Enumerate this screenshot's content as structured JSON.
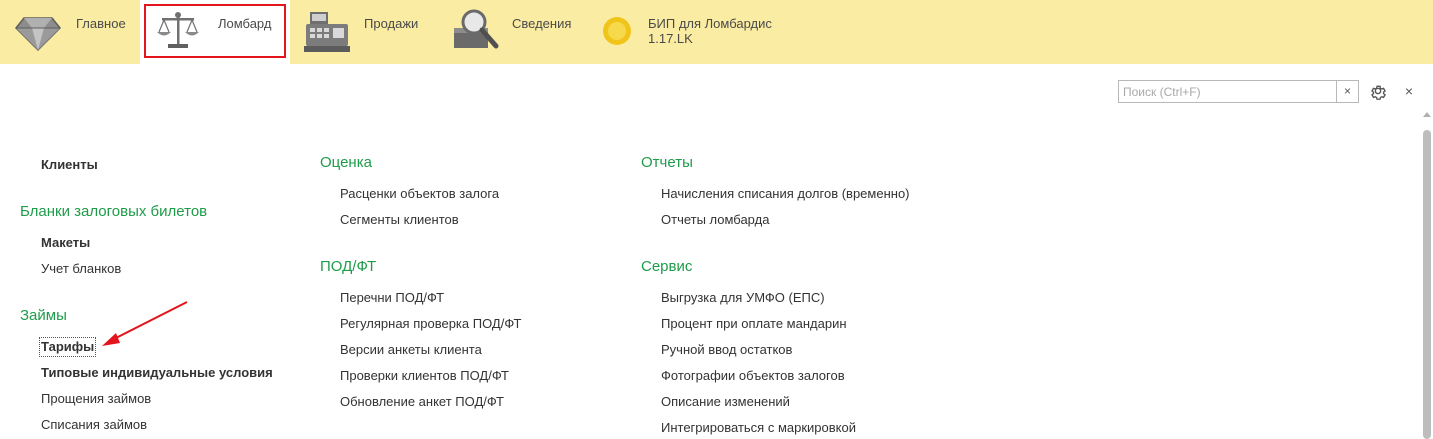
{
  "sections": [
    {
      "label": "Главное",
      "icon": "diamond-icon"
    },
    {
      "label": "Ломбард",
      "icon": "scales-icon"
    },
    {
      "label": "Продажи",
      "icon": "cash-register-icon"
    },
    {
      "label": "Сведения",
      "icon": "magnifier-icon"
    },
    {
      "label": "БИП для Ломбардис",
      "label2": "1.17.LK",
      "icon": "coin-icon"
    }
  ],
  "toolbar": {
    "search_placeholder": "Поиск (Ctrl+F)",
    "search_value": "",
    "clear_glyph": "×",
    "close_glyph": "×"
  },
  "col1": {
    "clients": "Клиенты",
    "blanks_title": "Бланки залоговых билетов",
    "blanks_items": [
      "Макеты",
      "Учет бланков"
    ],
    "loans_title": "Займы",
    "loans_items": [
      "Тарифы",
      "Типовые индивидуальные условия",
      "Прощения займов",
      "Списания займов"
    ]
  },
  "col2": {
    "eval_title": "Оценка",
    "eval_items": [
      "Расценки объектов залога",
      "Сегменты клиентов"
    ],
    "pod_title": "ПОД/ФТ",
    "pod_items": [
      "Перечни ПОД/ФТ",
      "Регулярная проверка ПОД/ФТ",
      "Версии анкеты клиента",
      "Проверки клиентов ПОД/ФТ",
      "Обновление анкет ПОД/ФТ"
    ]
  },
  "col3": {
    "reports_title": "Отчеты",
    "reports_items": [
      "Начисления списания долгов (временно)",
      "Отчеты ломбарда"
    ],
    "service_title": "Сервис",
    "service_items": [
      "Выгрузка для УМФО (ЕПС)",
      "Процент при оплате мандарин",
      "Ручной ввод остатков",
      "Фотографии объектов залогов",
      "Описание изменений",
      "Интегрироваться с маркировкой"
    ]
  },
  "colors": {
    "section_bar": "#fbeca3",
    "group_title": "#1e9c4a",
    "highlight": "#e3141b"
  }
}
